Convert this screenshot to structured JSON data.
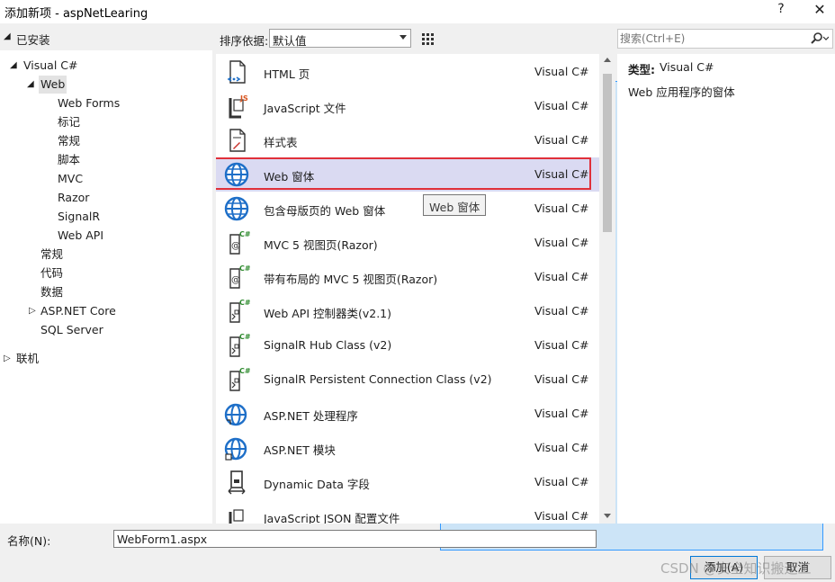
{
  "window": {
    "title": "添加新项 - aspNetLearing",
    "help_glyph": "?",
    "close_glyph": "✕"
  },
  "left_panel": {
    "header": "已安装",
    "tree": [
      {
        "label": "Visual C#",
        "expander": "◢"
      },
      {
        "label": "Web",
        "expander": "◢",
        "selected": true
      },
      {
        "label": "Web Forms"
      },
      {
        "label": "标记"
      },
      {
        "label": "常规"
      },
      {
        "label": "脚本"
      },
      {
        "label": "MVC"
      },
      {
        "label": "Razor"
      },
      {
        "label": "SignalR"
      },
      {
        "label": "Web API"
      },
      {
        "label": "常规"
      },
      {
        "label": "代码"
      },
      {
        "label": "数据"
      },
      {
        "label": "ASP.NET Core",
        "expander": "▷"
      },
      {
        "label": "SQL Server"
      }
    ],
    "online": {
      "label": "联机",
      "expander": "▷"
    }
  },
  "sort": {
    "label": "排序依据:",
    "value": "默认值"
  },
  "search": {
    "placeholder": "搜索(Ctrl+E)"
  },
  "templates": [
    {
      "name": "HTML 页",
      "lang": "Visual C#",
      "icon": "html-page-icon"
    },
    {
      "name": "JavaScript 文件",
      "lang": "Visual C#",
      "icon": "javascript-file-icon"
    },
    {
      "name": "样式表",
      "lang": "Visual C#",
      "icon": "stylesheet-icon"
    },
    {
      "name": "Web 窗体",
      "lang": "Visual C#",
      "icon": "globe-icon",
      "selected": true
    },
    {
      "name": "包含母版页的 Web 窗体",
      "lang": "Visual C#",
      "icon": "globe-icon"
    },
    {
      "name": "MVC 5 视图页(Razor)",
      "lang": "Visual C#",
      "icon": "razor-view-icon"
    },
    {
      "name": "带有布局的 MVC 5 视图页(Razor)",
      "lang": "Visual C#",
      "icon": "razor-view-icon"
    },
    {
      "name": "Web API 控制器类(v2.1)",
      "lang": "Visual C#",
      "icon": "csharp-class-icon"
    },
    {
      "name": "SignalR Hub Class (v2)",
      "lang": "Visual C#",
      "icon": "csharp-class-icon"
    },
    {
      "name": "SignalR Persistent Connection Class (v2)",
      "lang": "Visual C#",
      "icon": "csharp-class-icon"
    },
    {
      "name": "ASP.NET 处理程序",
      "lang": "Visual C#",
      "icon": "aspnet-globe-icon"
    },
    {
      "name": "ASP.NET 模块",
      "lang": "Visual C#",
      "icon": "aspnet-globe-icon"
    },
    {
      "name": "Dynamic Data 字段",
      "lang": "Visual C#",
      "icon": "dynamic-data-icon"
    },
    {
      "name": "JavaScript JSON 配置文件",
      "lang": "Visual C#",
      "icon": "json-file-icon"
    }
  ],
  "tooltip": "Web 窗体",
  "details": {
    "type_label": "类型:",
    "type_value": "Visual C#",
    "description": "Web 应用程序的窗体"
  },
  "bottom": {
    "name_label": "名称(N):",
    "name_value": "WebForm1.aspx",
    "add_button": "添加(A)",
    "cancel_button": "取消",
    "watermark": "CSDN @安全知识搬运工"
  },
  "colors": {
    "selection_bg": "#dadaf2",
    "selection_border": "#e0303a",
    "accent": "#0078d7"
  }
}
